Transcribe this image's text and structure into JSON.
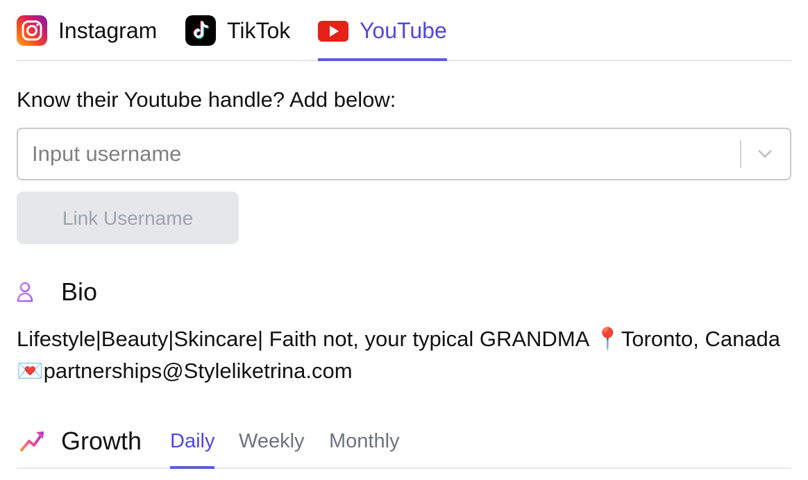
{
  "platform_tabs": [
    {
      "label": "Instagram",
      "icon": "instagram-icon",
      "active": false
    },
    {
      "label": "TikTok",
      "icon": "tiktok-icon",
      "active": false
    },
    {
      "label": "YouTube",
      "icon": "youtube-icon",
      "active": true
    }
  ],
  "handle": {
    "prompt": "Know their Youtube handle? Add below:",
    "placeholder": "Input username",
    "value": "",
    "link_button_label": "Link Username"
  },
  "bio": {
    "title": "Bio",
    "text": "Lifestyle|Beauty|Skincare| Faith not, your typical GRANDMA 📍Toronto, Canada 💌partnerships@Styleliketrina.com"
  },
  "growth": {
    "title": "Growth",
    "tabs": [
      {
        "label": "Daily",
        "active": true
      },
      {
        "label": "Weekly",
        "active": false
      },
      {
        "label": "Monthly",
        "active": false
      }
    ]
  },
  "colors": {
    "accent": "#4f46e5",
    "youtube_red": "#e62117",
    "disabled_bg": "#e5e7eb",
    "disabled_text": "#9ca3af",
    "bio_icon": "#a855f7"
  }
}
